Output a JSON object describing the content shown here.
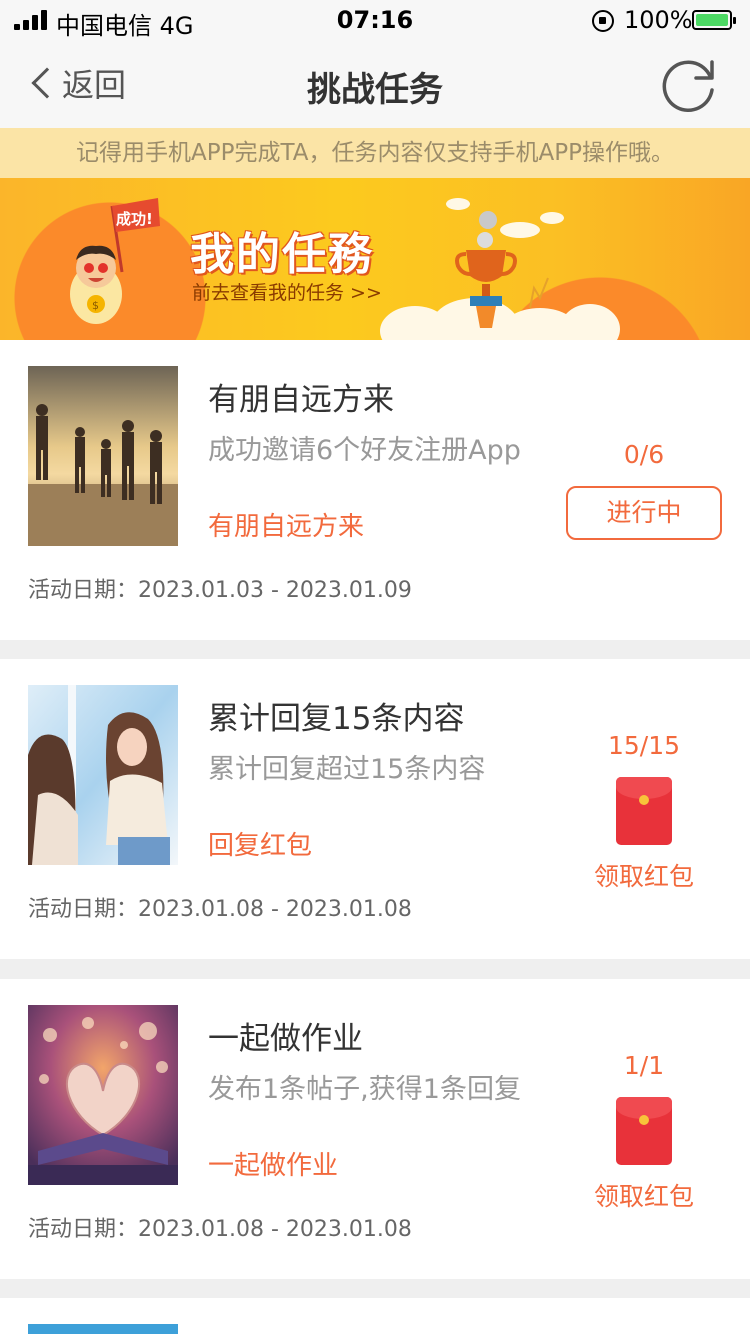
{
  "status_bar": {
    "carrier": "中国电信  4G",
    "time": "07:16",
    "battery": "100%"
  },
  "nav": {
    "back_label": "返回",
    "title": "挑战任务",
    "refresh_icon": "refresh-icon"
  },
  "notice": "记得用手机APP完成TA，任务内容仅支持手机APP操作哦。",
  "banner": {
    "title": "我的任務",
    "flag_text": "成功!",
    "subtitle": "前去查看我的任务 >>"
  },
  "tasks": [
    {
      "title": "有朋自远方来",
      "desc": "成功邀请6个好友注册App",
      "link": "有朋自远方来",
      "date": "活动日期：2023.01.03 - 2023.01.09",
      "progress": "0/6",
      "status": "进行中",
      "thumb": "beach-friends-photo"
    },
    {
      "title": "累计回复15条内容",
      "desc": "累计回复超过15条内容",
      "link": "回复红包",
      "date": "活动日期：2023.01.08 - 2023.01.08",
      "progress": "15/15",
      "status": "领取红包",
      "thumb": "two-girls-photo"
    },
    {
      "title": "一起做作业",
      "desc": "发布1条帖子,获得1条回复",
      "link": "一起做作业",
      "date": "活动日期：2023.01.08 - 2023.01.08",
      "progress": "1/1",
      "status": "领取红包",
      "thumb": "heart-book-photo"
    }
  ],
  "colors": {
    "accent": "#f26a3d",
    "notice_bg": "#fbe4a6",
    "redpacket": "#e8323a"
  }
}
